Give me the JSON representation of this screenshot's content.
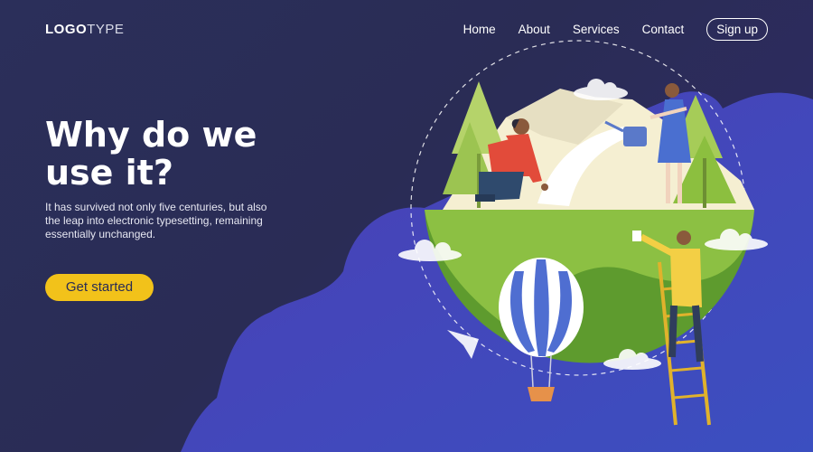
{
  "header": {
    "logo_bold": "LOGO",
    "logo_light": "TYPE",
    "nav": [
      "Home",
      "About",
      "Services",
      "Contact"
    ],
    "signup_label": "Sign up"
  },
  "hero": {
    "title_line1": "Why do we",
    "title_line2": "use it?",
    "description": "It has survived not only five centuries, but also the leap into electronic typesetting, remaining essentially unchanged.",
    "cta_label": "Get started"
  },
  "colors": {
    "background": "#2b2f5a",
    "cloud_bg": "#4f3fbf",
    "accent": "#f2c21a",
    "globe_green": "#8cbf3f"
  }
}
